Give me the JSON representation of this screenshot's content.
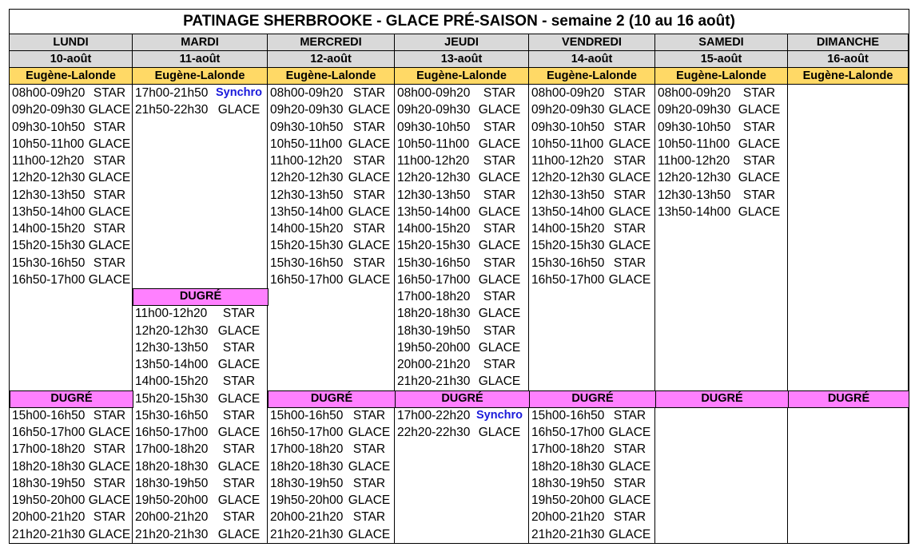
{
  "title": "PATINAGE SHERBROOKE - GLACE PRÉ-SAISON - semaine 2 (10 au 16 août)",
  "days": [
    {
      "name": "LUNDI",
      "date": "10-août",
      "venue1": "Eugène-Lalonde",
      "venue2": "DUGRÉ"
    },
    {
      "name": "MARDI",
      "date": "11-août",
      "venue1": "Eugène-Lalonde",
      "venue2": "DUGRÉ"
    },
    {
      "name": "MERCREDI",
      "date": "12-août",
      "venue1": "Eugène-Lalonde",
      "venue2": "DUGRÉ"
    },
    {
      "name": "JEUDI",
      "date": "13-août",
      "venue1": "Eugène-Lalonde",
      "venue2": "DUGRÉ"
    },
    {
      "name": "VENDREDI",
      "date": "14-août",
      "venue1": "Eugène-Lalonde",
      "venue2": "DUGRÉ"
    },
    {
      "name": "SAMEDI",
      "date": "15-août",
      "venue1": "Eugène-Lalonde",
      "venue2": "DUGRÉ"
    },
    {
      "name": "DIMANCHE",
      "date": "16-août",
      "venue1": "Eugène-Lalonde",
      "venue2": "DUGRÉ"
    }
  ],
  "schedule": {
    "lundi_el": [
      {
        "time": "08h00-09h20",
        "type": "STAR"
      },
      {
        "time": "09h20-09h30",
        "type": "GLACE"
      },
      {
        "time": "09h30-10h50",
        "type": "STAR"
      },
      {
        "time": "10h50-11h00",
        "type": "GLACE"
      },
      {
        "time": "11h00-12h20",
        "type": "STAR"
      },
      {
        "time": "12h20-12h30",
        "type": "GLACE"
      },
      {
        "time": "12h30-13h50",
        "type": "STAR"
      },
      {
        "time": "13h50-14h00",
        "type": "GLACE"
      },
      {
        "time": "14h00-15h20",
        "type": "STAR"
      },
      {
        "time": "15h20-15h30",
        "type": "GLACE"
      },
      {
        "time": "15h30-16h50",
        "type": "STAR"
      },
      {
        "time": "16h50-17h00",
        "type": "GLACE"
      }
    ],
    "lundi_dg": [
      {
        "time": "15h00-16h50",
        "type": "STAR"
      },
      {
        "time": "16h50-17h00",
        "type": "GLACE"
      },
      {
        "time": "17h00-18h20",
        "type": "STAR"
      },
      {
        "time": "18h20-18h30",
        "type": "GLACE"
      },
      {
        "time": "18h30-19h50",
        "type": "STAR"
      },
      {
        "time": "19h50-20h00",
        "type": "GLACE"
      },
      {
        "time": "20h00-21h20",
        "type": "STAR"
      },
      {
        "time": "21h20-21h30",
        "type": "GLACE"
      }
    ],
    "mardi_el": [
      {
        "time": "17h00-21h50",
        "type": "Synchro"
      },
      {
        "time": "21h50-22h30",
        "type": "GLACE"
      }
    ],
    "mardi_dg": [
      {
        "time": "11h00-12h20",
        "type": "STAR"
      },
      {
        "time": "12h20-12h30",
        "type": "GLACE"
      },
      {
        "time": "12h30-13h50",
        "type": "STAR"
      },
      {
        "time": "13h50-14h00",
        "type": "GLACE"
      },
      {
        "time": "14h00-15h20",
        "type": "STAR"
      },
      {
        "time": "15h20-15h30",
        "type": "GLACE"
      },
      {
        "time": "15h30-16h50",
        "type": "STAR"
      },
      {
        "time": "16h50-17h00",
        "type": "GLACE"
      },
      {
        "time": "17h00-18h20",
        "type": "STAR"
      },
      {
        "time": "18h20-18h30",
        "type": "GLACE"
      },
      {
        "time": "18h30-19h50",
        "type": "STAR"
      },
      {
        "time": "19h50-20h00",
        "type": "GLACE"
      },
      {
        "time": "20h00-21h20",
        "type": "STAR"
      },
      {
        "time": "21h20-21h30",
        "type": "GLACE"
      }
    ],
    "mercredi_el": [
      {
        "time": "08h00-09h20",
        "type": "STAR"
      },
      {
        "time": "09h20-09h30",
        "type": "GLACE"
      },
      {
        "time": "09h30-10h50",
        "type": "STAR"
      },
      {
        "time": "10h50-11h00",
        "type": "GLACE"
      },
      {
        "time": "11h00-12h20",
        "type": "STAR"
      },
      {
        "time": "12h20-12h30",
        "type": "GLACE"
      },
      {
        "time": "12h30-13h50",
        "type": "STAR"
      },
      {
        "time": "13h50-14h00",
        "type": "GLACE"
      },
      {
        "time": "14h00-15h20",
        "type": "STAR"
      },
      {
        "time": "15h20-15h30",
        "type": "GLACE"
      },
      {
        "time": "15h30-16h50",
        "type": "STAR"
      },
      {
        "time": "16h50-17h00",
        "type": "GLACE"
      }
    ],
    "mercredi_dg": [
      {
        "time": "15h00-16h50",
        "type": "STAR"
      },
      {
        "time": "16h50-17h00",
        "type": "GLACE"
      },
      {
        "time": "17h00-18h20",
        "type": "STAR"
      },
      {
        "time": "18h20-18h30",
        "type": "GLACE"
      },
      {
        "time": "18h30-19h50",
        "type": "STAR"
      },
      {
        "time": "19h50-20h00",
        "type": "GLACE"
      },
      {
        "time": "20h00-21h20",
        "type": "STAR"
      },
      {
        "time": "21h20-21h30",
        "type": "GLACE"
      }
    ],
    "jeudi_el": [
      {
        "time": "08h00-09h20",
        "type": "STAR"
      },
      {
        "time": "09h20-09h30",
        "type": "GLACE"
      },
      {
        "time": "09h30-10h50",
        "type": "STAR"
      },
      {
        "time": "10h50-11h00",
        "type": "GLACE"
      },
      {
        "time": "11h00-12h20",
        "type": "STAR"
      },
      {
        "time": "12h20-12h30",
        "type": "GLACE"
      },
      {
        "time": "12h30-13h50",
        "type": "STAR"
      },
      {
        "time": "13h50-14h00",
        "type": "GLACE"
      },
      {
        "time": "14h00-15h20",
        "type": "STAR"
      },
      {
        "time": "15h20-15h30",
        "type": "GLACE"
      },
      {
        "time": "15h30-16h50",
        "type": "STAR"
      },
      {
        "time": "16h50-17h00",
        "type": "GLACE"
      },
      {
        "time": "17h00-18h20",
        "type": "STAR"
      },
      {
        "time": "18h20-18h30",
        "type": "GLACE"
      },
      {
        "time": "18h30-19h50",
        "type": "STAR"
      },
      {
        "time": "19h50-20h00",
        "type": "GLACE"
      },
      {
        "time": "20h00-21h20",
        "type": "STAR"
      },
      {
        "time": "21h20-21h30",
        "type": "GLACE"
      }
    ],
    "jeudi_dg": [
      {
        "time": "17h00-22h20",
        "type": "Synchro"
      },
      {
        "time": "22h20-22h30",
        "type": "GLACE"
      }
    ],
    "vendredi_el": [
      {
        "time": "08h00-09h20",
        "type": "STAR"
      },
      {
        "time": "09h20-09h30",
        "type": "GLACE"
      },
      {
        "time": "09h30-10h50",
        "type": "STAR"
      },
      {
        "time": "10h50-11h00",
        "type": "GLACE"
      },
      {
        "time": "11h00-12h20",
        "type": "STAR"
      },
      {
        "time": "12h20-12h30",
        "type": "GLACE"
      },
      {
        "time": "12h30-13h50",
        "type": "STAR"
      },
      {
        "time": "13h50-14h00",
        "type": "GLACE"
      },
      {
        "time": "14h00-15h20",
        "type": "STAR"
      },
      {
        "time": "15h20-15h30",
        "type": "GLACE"
      },
      {
        "time": "15h30-16h50",
        "type": "STAR"
      },
      {
        "time": "16h50-17h00",
        "type": "GLACE"
      }
    ],
    "vendredi_dg": [
      {
        "time": "15h00-16h50",
        "type": "STAR"
      },
      {
        "time": "16h50-17h00",
        "type": "GLACE"
      },
      {
        "time": "17h00-18h20",
        "type": "STAR"
      },
      {
        "time": "18h20-18h30",
        "type": "GLACE"
      },
      {
        "time": "18h30-19h50",
        "type": "STAR"
      },
      {
        "time": "19h50-20h00",
        "type": "GLACE"
      },
      {
        "time": "20h00-21h20",
        "type": "STAR"
      },
      {
        "time": "21h20-21h30",
        "type": "GLACE"
      }
    ],
    "samedi_el": [
      {
        "time": "08h00-09h20",
        "type": "STAR"
      },
      {
        "time": "09h20-09h30",
        "type": "GLACE"
      },
      {
        "time": "09h30-10h50",
        "type": "STAR"
      },
      {
        "time": "10h50-11h00",
        "type": "GLACE"
      },
      {
        "time": "11h00-12h20",
        "type": "STAR"
      },
      {
        "time": "12h20-12h30",
        "type": "GLACE"
      },
      {
        "time": "12h30-13h50",
        "type": "STAR"
      },
      {
        "time": "13h50-14h00",
        "type": "GLACE"
      }
    ],
    "samedi_dg": [],
    "dimanche_el": [],
    "dimanche_dg": []
  }
}
